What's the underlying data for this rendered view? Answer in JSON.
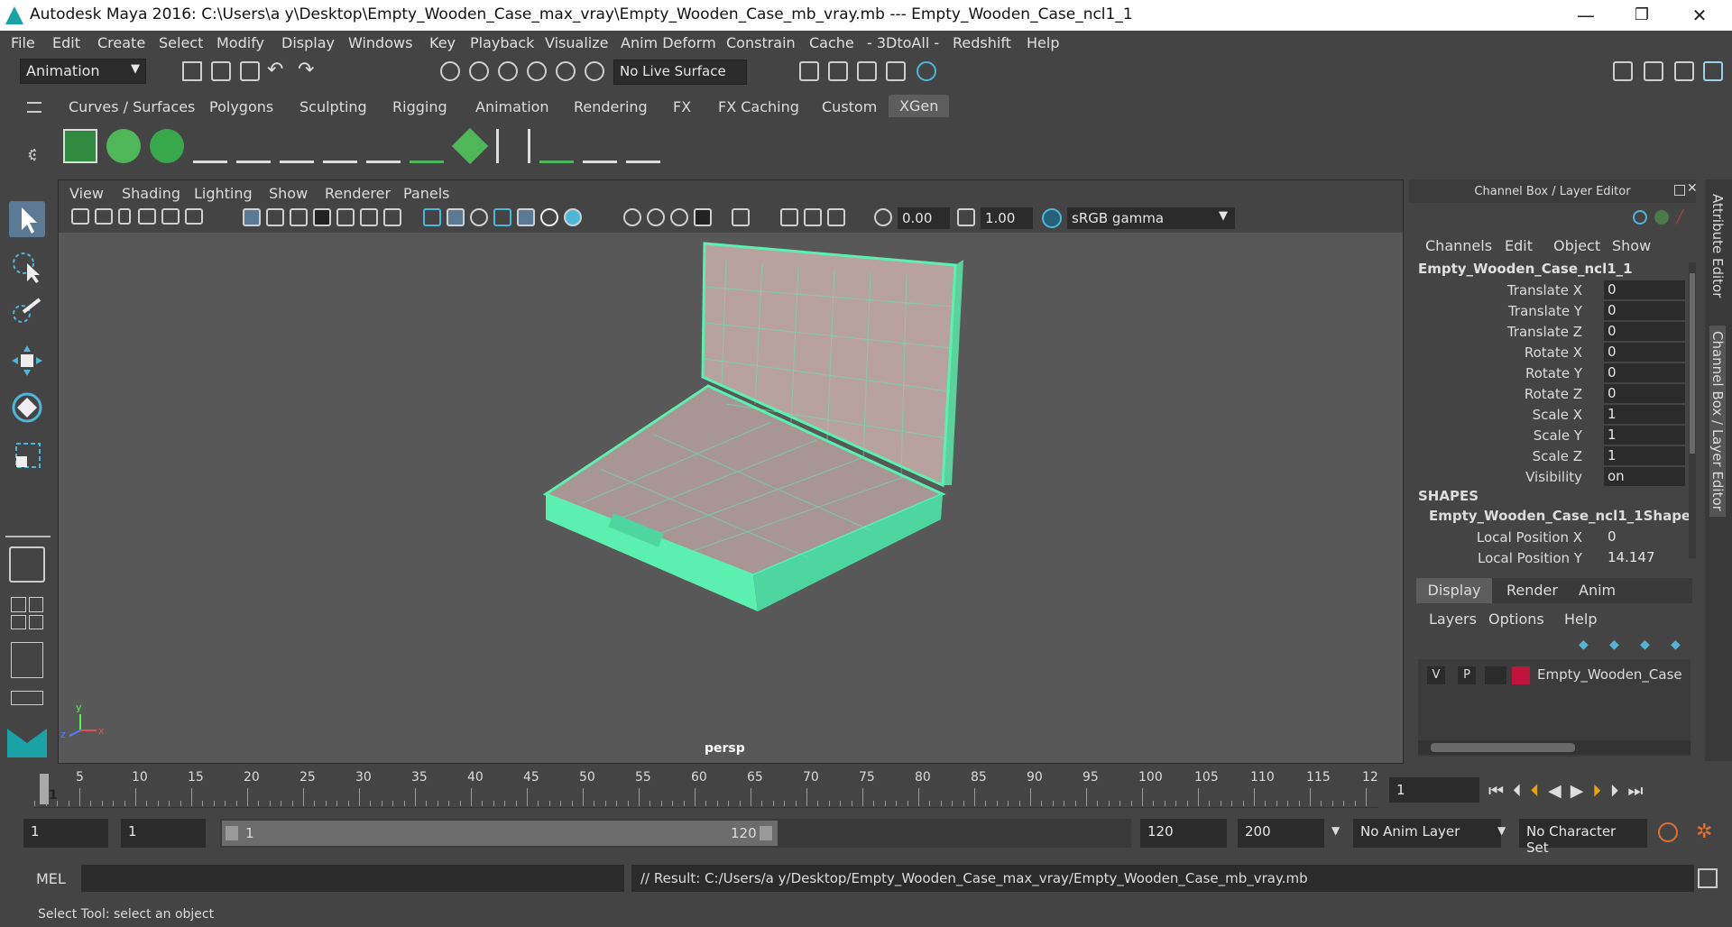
{
  "window": {
    "title": "Autodesk Maya 2016: C:\\Users\\a y\\Desktop\\Empty_Wooden_Case_max_vray\\Empty_Wooden_Case_mb_vray.mb   ---   Empty_Wooden_Case_ncl1_1",
    "minimize": "—",
    "maximize": "❐",
    "close": "✕"
  },
  "menubar": [
    "File",
    "Edit",
    "Create",
    "Select",
    "Modify",
    "Display",
    "Windows",
    "Key",
    "Playback",
    "Visualize",
    "Anim Deform",
    "Constrain",
    "Cache",
    "- 3DtoAll -",
    "Redshift",
    "Help"
  ],
  "toolbar": {
    "mode": "Animation",
    "live_surface": "No Live Surface"
  },
  "shelf_tabs": [
    "Curves / Surfaces",
    "Polygons",
    "Sculpting",
    "Rigging",
    "Animation",
    "Rendering",
    "FX",
    "FX Caching",
    "Custom",
    "XGen"
  ],
  "shelf_active": "XGen",
  "viewport": {
    "menu": [
      "View",
      "Shading",
      "Lighting",
      "Show",
      "Renderer",
      "Panels"
    ],
    "exposure": "0.00",
    "gamma": "1.00",
    "color_space": "sRGB gamma",
    "camera_label": "persp",
    "axis_y": "y",
    "axis_x": "x",
    "axis_z": "z"
  },
  "channel_box": {
    "title": "Channel Box / Layer Editor",
    "menu": [
      "Channels",
      "Edit",
      "Object",
      "Show"
    ],
    "object_name": "Empty_Wooden_Case_ncl1_1",
    "channels": [
      {
        "label": "Translate X",
        "value": "0"
      },
      {
        "label": "Translate Y",
        "value": "0"
      },
      {
        "label": "Translate Z",
        "value": "0"
      },
      {
        "label": "Rotate X",
        "value": "0"
      },
      {
        "label": "Rotate Y",
        "value": "0"
      },
      {
        "label": "Rotate Z",
        "value": "0"
      },
      {
        "label": "Scale X",
        "value": "1"
      },
      {
        "label": "Scale Y",
        "value": "1"
      },
      {
        "label": "Scale Z",
        "value": "1"
      },
      {
        "label": "Visibility",
        "value": "on"
      }
    ],
    "shapes_header": "SHAPES",
    "shape_name": "Empty_Wooden_Case_ncl1_1Shape",
    "shape_channels": [
      {
        "label": "Local Position X",
        "value": "0"
      },
      {
        "label": "Local Position Y",
        "value": "14.147"
      }
    ]
  },
  "layer_editor": {
    "tabs": [
      "Display",
      "Render",
      "Anim"
    ],
    "menu": [
      "Layers",
      "Options",
      "Help"
    ],
    "layer": {
      "v": "V",
      "p": "P",
      "name": "Empty_Wooden_Case",
      "color": "#c0143c"
    }
  },
  "side_tabs": {
    "attribute_editor": "Attribute Editor",
    "channel_box": "Channel Box / Layer Editor"
  },
  "timeline": {
    "current_frame_marker": "1",
    "labels": [
      "5",
      "10",
      "15",
      "20",
      "25",
      "30",
      "35",
      "40",
      "45",
      "50",
      "55",
      "60",
      "65",
      "70",
      "75",
      "80",
      "85",
      "90",
      "95",
      "100",
      "105",
      "110",
      "115",
      "12"
    ],
    "current_frame": "1"
  },
  "range": {
    "start_field": "1",
    "playback_start": "1",
    "slider_start": "1",
    "slider_end": "120",
    "playback_end": "120",
    "end_field": "200",
    "anim_layer": "No Anim Layer",
    "character_set": "No Character Set"
  },
  "command": {
    "lang": "MEL",
    "result": "// Result: C:/Users/a y/Desktop/Empty_Wooden_Case_max_vray/Empty_Wooden_Case_mb_vray.mb"
  },
  "status": "Select Tool: select an object",
  "colors": {
    "wire": "#5cf0b0",
    "accent": "#1aa3a6"
  }
}
